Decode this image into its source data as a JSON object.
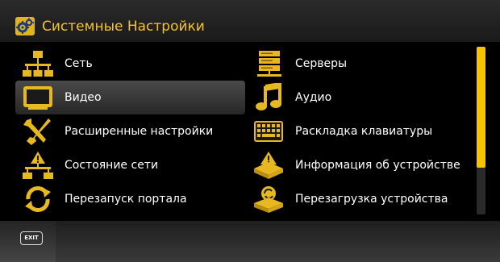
{
  "header": {
    "title": "Системные Настройки",
    "icon": "gears-icon"
  },
  "menu": {
    "left": [
      {
        "label": "Сеть",
        "icon": "network-icon",
        "selected": false
      },
      {
        "label": "Видео",
        "icon": "monitor-icon",
        "selected": true
      },
      {
        "label": "Расширенные настройки",
        "icon": "tools-icon",
        "selected": false
      },
      {
        "label": "Состояние сети",
        "icon": "network-info-icon",
        "selected": false
      },
      {
        "label": "Перезапуск портала",
        "icon": "refresh-icon",
        "selected": false
      }
    ],
    "right": [
      {
        "label": "Серверы",
        "icon": "server-icon",
        "selected": false
      },
      {
        "label": "Аудио",
        "icon": "music-note-icon",
        "selected": false
      },
      {
        "label": "Раскладка клавиатуры",
        "icon": "keyboard-icon",
        "selected": false
      },
      {
        "label": "Информация об устройстве",
        "icon": "device-info-icon",
        "selected": false
      },
      {
        "label": "Перезагрузка устройства",
        "icon": "device-reboot-icon",
        "selected": false
      }
    ]
  },
  "footer": {
    "exit_label": "EXIT"
  },
  "colors": {
    "accent": "#f4c430",
    "icon": "#e8b820",
    "scrollbar": "#f5c300"
  }
}
